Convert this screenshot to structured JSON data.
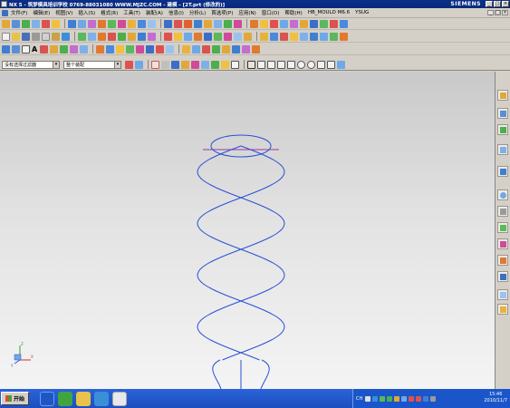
{
  "window": {
    "title": "NX 5 - 筑梦模具培训学校 0769-88031080 WWW.MJZC.COM - 建模 - [2T.prt (修改的)]",
    "brand": "SIEMENS",
    "controls": [
      "_",
      "□",
      "×"
    ]
  },
  "menu": {
    "items": [
      "文件(F)",
      "编辑(E)",
      "视图(V)",
      "插入(S)",
      "格式(R)",
      "工具(T)",
      "装配(A)",
      "信息(I)",
      "分析(L)",
      "首选项(P)",
      "应用(N)",
      "窗口(O)",
      "帮助(H)",
      "HB_MOULD M6.6",
      "YSUG"
    ],
    "mdi_controls": [
      "_",
      "□",
      "×"
    ]
  },
  "toolbar3": {
    "text_tool_label": "A"
  },
  "selection_bar": {
    "filter_value": "没有选择过滤器",
    "scope_value": "整个装配"
  },
  "colors": {
    "curve": "#2a4ed6",
    "guide_line": "#9c3aa2",
    "background_top": "#c9c9c9",
    "background_bottom": "#f4f4f4",
    "taskbar": "#1f56c6"
  },
  "triad": {
    "x_label": "X",
    "y_label": "Y",
    "z_label": "Z"
  },
  "taskbar": {
    "start_label": "开始",
    "ime_label": "CH",
    "clock_time": "15:46",
    "clock_date": "2010/11/7"
  }
}
